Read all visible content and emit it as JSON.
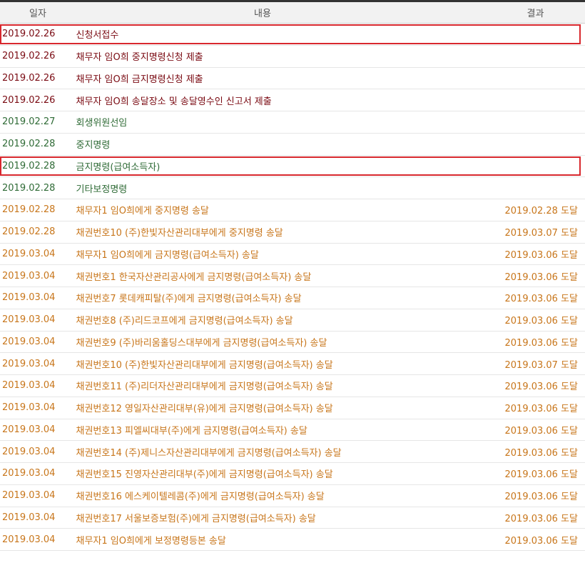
{
  "header": {
    "date": "일자",
    "content": "내용",
    "result": "결과"
  },
  "colors": {
    "red": "#7a0a12",
    "green": "#2f6b36",
    "orange": "#c8761b",
    "highlight_border": "#d8282e"
  },
  "rows": [
    {
      "date": "2019.02.26",
      "content": "신청서접수",
      "result": "",
      "tone": "red",
      "highlighted": true
    },
    {
      "date": "2019.02.26",
      "content": "채무자 임O희 중지명령신청 제출",
      "result": "",
      "tone": "red",
      "highlighted": false
    },
    {
      "date": "2019.02.26",
      "content": "채무자 임O희 금지명령신청 제출",
      "result": "",
      "tone": "red",
      "highlighted": false
    },
    {
      "date": "2019.02.26",
      "content": "채무자 임O희 송달장소 및 송달영수인 신고서 제출",
      "result": "",
      "tone": "red",
      "highlighted": false
    },
    {
      "date": "2019.02.27",
      "content": "회생위원선임",
      "result": "",
      "tone": "green",
      "highlighted": false
    },
    {
      "date": "2019.02.28",
      "content": "중지명령",
      "result": "",
      "tone": "green",
      "highlighted": false
    },
    {
      "date": "2019.02.28",
      "content": "금지명령(급여소득자)",
      "result": "",
      "tone": "green",
      "highlighted": true
    },
    {
      "date": "2019.02.28",
      "content": "기타보정명령",
      "result": "",
      "tone": "green",
      "highlighted": false
    },
    {
      "date": "2019.02.28",
      "content": "채무자1 임O희에게 중지명령 송달",
      "result": "2019.02.28 도달",
      "tone": "orange",
      "highlighted": false
    },
    {
      "date": "2019.02.28",
      "content": "채권번호10 (주)한빛자산관리대부에게 중지명령 송달",
      "result": "2019.03.07 도달",
      "tone": "orange",
      "highlighted": false
    },
    {
      "date": "2019.03.04",
      "content": "채무자1 임O희에게 금지명령(급여소득자) 송달",
      "result": "2019.03.06 도달",
      "tone": "orange",
      "highlighted": false
    },
    {
      "date": "2019.03.04",
      "content": "채권번호1 한국자산관리공사에게 금지명령(급여소득자) 송달",
      "result": "2019.03.06 도달",
      "tone": "orange",
      "highlighted": false
    },
    {
      "date": "2019.03.04",
      "content": "채권번호7 롯데캐피탈(주)에게 금지명령(급여소득자) 송달",
      "result": "2019.03.06 도달",
      "tone": "orange",
      "highlighted": false
    },
    {
      "date": "2019.03.04",
      "content": "채권번호8 (주)리드코프에게 금지명령(급여소득자) 송달",
      "result": "2019.03.06 도달",
      "tone": "orange",
      "highlighted": false
    },
    {
      "date": "2019.03.04",
      "content": "채권번호9 (주)바리움홀딩스대부에게 금지명령(급여소득자) 송달",
      "result": "2019.03.06 도달",
      "tone": "orange",
      "highlighted": false
    },
    {
      "date": "2019.03.04",
      "content": "채권번호10 (주)한빛자산관리대부에게 금지명령(급여소득자) 송달",
      "result": "2019.03.07 도달",
      "tone": "orange",
      "highlighted": false
    },
    {
      "date": "2019.03.04",
      "content": "채권번호11 (주)리더자산관리대부에게 금지명령(급여소득자) 송달",
      "result": "2019.03.06 도달",
      "tone": "orange",
      "highlighted": false
    },
    {
      "date": "2019.03.04",
      "content": "채권번호12 영일자산관리대부(유)에게 금지명령(급여소득자) 송달",
      "result": "2019.03.06 도달",
      "tone": "orange",
      "highlighted": false
    },
    {
      "date": "2019.03.04",
      "content": "채권번호13 피엘씨대부(주)에게 금지명령(급여소득자) 송달",
      "result": "2019.03.06 도달",
      "tone": "orange",
      "highlighted": false
    },
    {
      "date": "2019.03.04",
      "content": "채권번호14 (주)제니스자산관리대부에게 금지명령(급여소득자) 송달",
      "result": "2019.03.06 도달",
      "tone": "orange",
      "highlighted": false
    },
    {
      "date": "2019.03.04",
      "content": "채권번호15 진영자산관리대부(주)에게 금지명령(급여소득자) 송달",
      "result": "2019.03.06 도달",
      "tone": "orange",
      "highlighted": false
    },
    {
      "date": "2019.03.04",
      "content": "채권번호16 에스케이텔레콤(주)에게 금지명령(급여소득자) 송달",
      "result": "2019.03.06 도달",
      "tone": "orange",
      "highlighted": false
    },
    {
      "date": "2019.03.04",
      "content": "채권번호17 서울보증보험(주)에게 금지명령(급여소득자) 송달",
      "result": "2019.03.06 도달",
      "tone": "orange",
      "highlighted": false
    },
    {
      "date": "2019.03.04",
      "content": "채무자1 임O희에게 보정명령등본 송달",
      "result": "2019.03.06 도달",
      "tone": "orange",
      "highlighted": false
    }
  ]
}
